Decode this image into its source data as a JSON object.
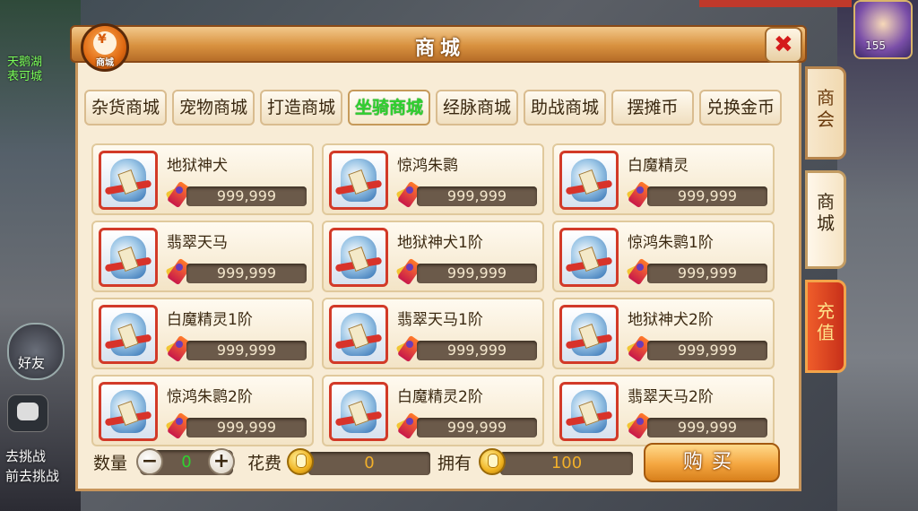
{
  "background": {
    "map_text_line1": "天鹅湖",
    "map_text_line2": "表可城",
    "friend_label": "好友",
    "chat_lines": [
      "去挑战",
      "前去挑战"
    ],
    "level": "155"
  },
  "dialog": {
    "title": "商城",
    "logo_label": "商城",
    "logo_symbol": "¥",
    "close_symbol": "✖"
  },
  "tabs": [
    {
      "label": "杂货商城",
      "active": false
    },
    {
      "label": "宠物商城",
      "active": false
    },
    {
      "label": "打造商城",
      "active": false
    },
    {
      "label": "坐骑商城",
      "active": true
    },
    {
      "label": "经脉商城",
      "active": false
    },
    {
      "label": "助战商城",
      "active": false
    },
    {
      "label": "摆摊币",
      "active": false
    },
    {
      "label": "兑换金币",
      "active": false
    }
  ],
  "items": [
    {
      "name": "地狱神犬",
      "price": "999,999"
    },
    {
      "name": "惊鸿朱鹮",
      "price": "999,999"
    },
    {
      "name": "白魔精灵",
      "price": "999,999"
    },
    {
      "name": "翡翠天马",
      "price": "999,999"
    },
    {
      "name": "地狱神犬1阶",
      "price": "999,999"
    },
    {
      "name": "惊鸿朱鹮1阶",
      "price": "999,999"
    },
    {
      "name": "白魔精灵1阶",
      "price": "999,999"
    },
    {
      "name": "翡翠天马1阶",
      "price": "999,999"
    },
    {
      "name": "地狱神犬2阶",
      "price": "999,999"
    },
    {
      "name": "惊鸿朱鹮2阶",
      "price": "999,999"
    },
    {
      "name": "白魔精灵2阶",
      "price": "999,999"
    },
    {
      "name": "翡翠天马2阶",
      "price": "999,999"
    }
  ],
  "bottom": {
    "quantity_label": "数量",
    "quantity_value": "0",
    "minus": "−",
    "plus": "+",
    "cost_label": "花费",
    "cost_value": "0",
    "owned_label": "拥有",
    "owned_value": "100",
    "buy_label": "购买"
  },
  "side_tabs": [
    {
      "label": "商会"
    },
    {
      "label": "商城"
    },
    {
      "label": "充值"
    }
  ],
  "colors": {
    "active_tab": "#2fd12f",
    "panel": "#f8ecd6",
    "buy_button": "#f4a640",
    "recharge_tab": "#c8301a"
  }
}
